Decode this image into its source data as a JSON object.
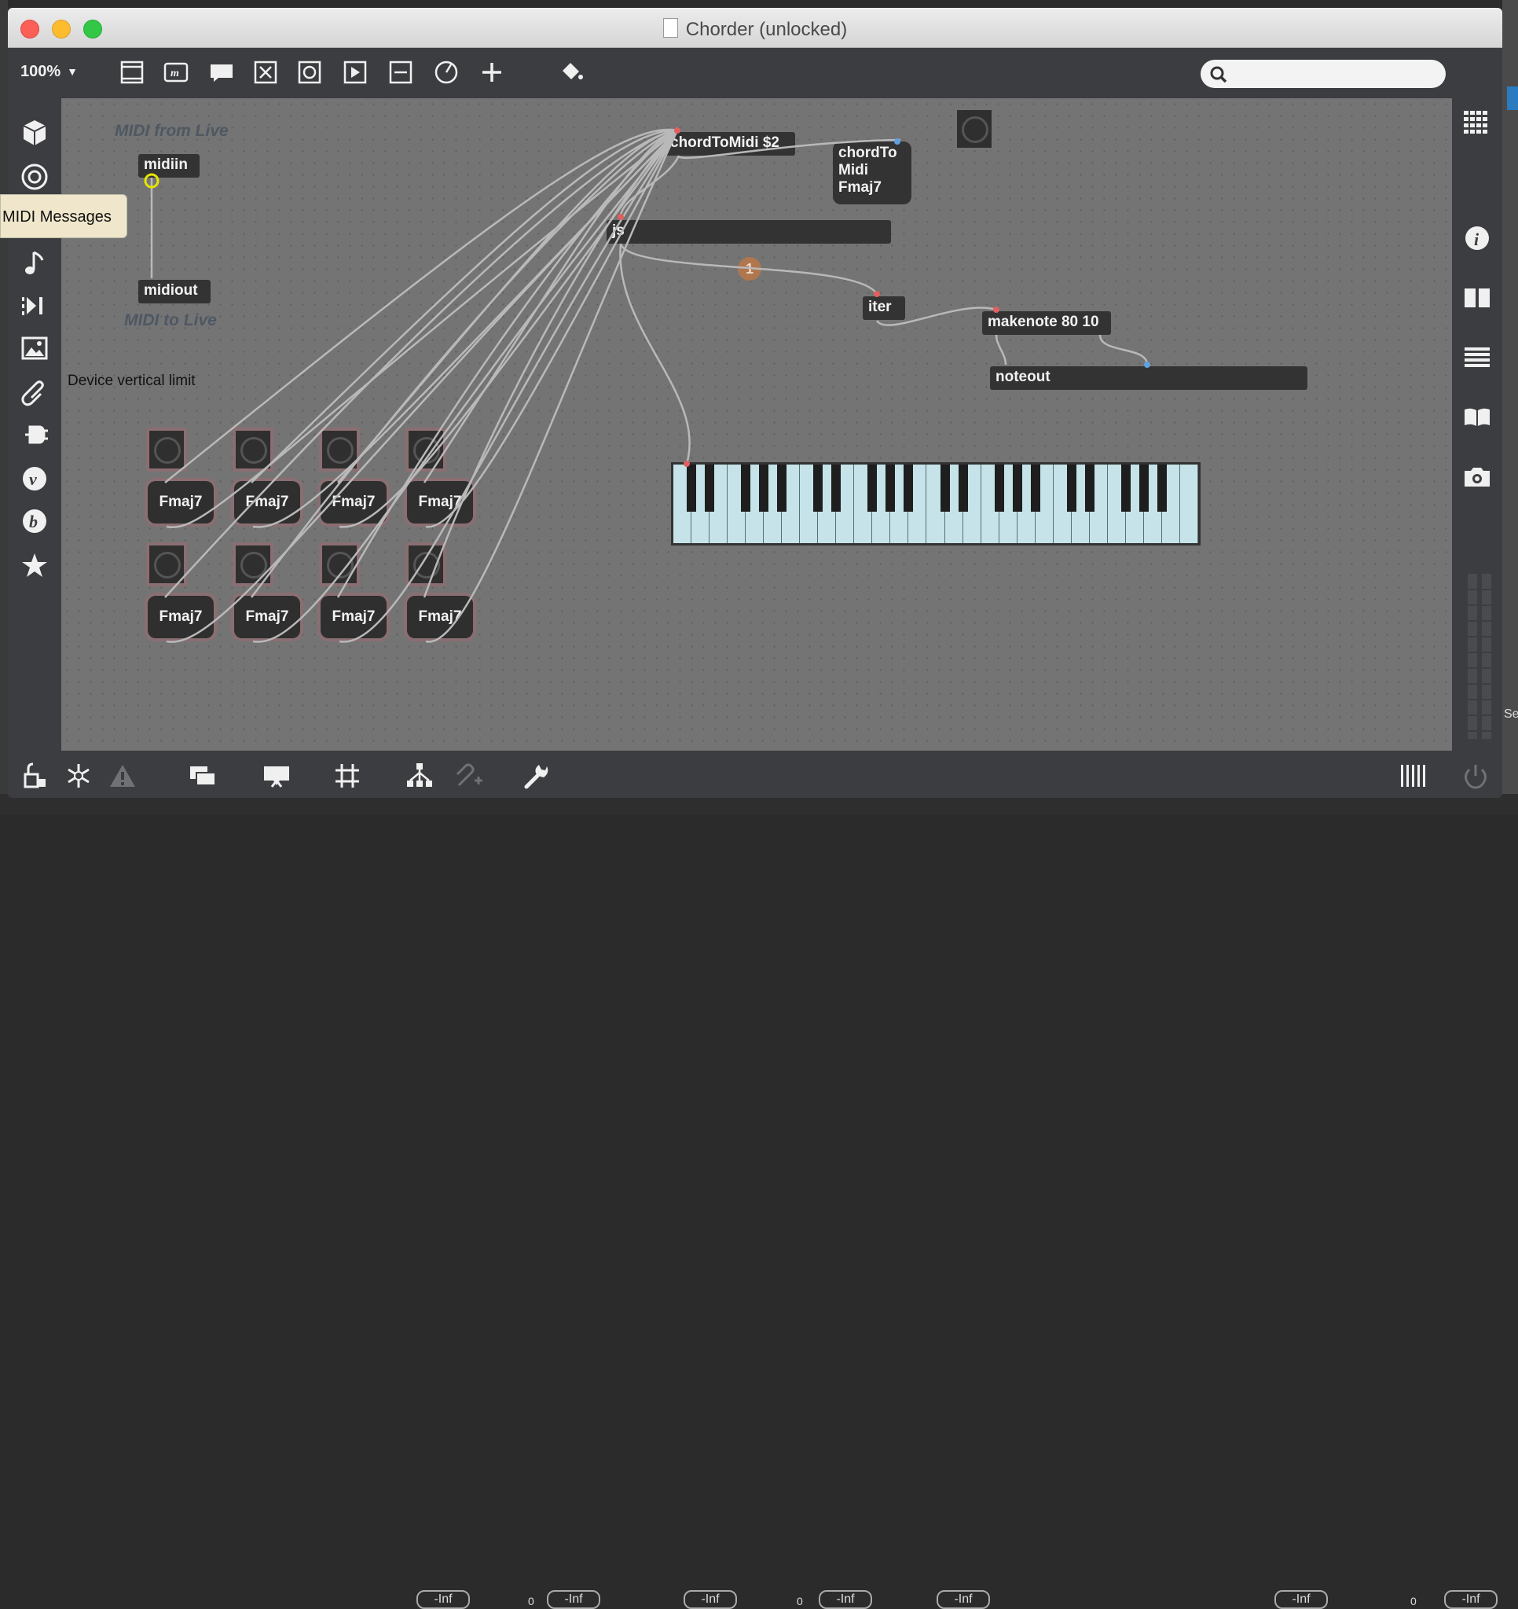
{
  "window": {
    "title": "Chorder (unlocked)"
  },
  "toolbar": {
    "zoom": "100%"
  },
  "search": {
    "placeholder": ""
  },
  "comments": {
    "midi_from_live": "MIDI from Live",
    "midi_to_live": "MIDI to Live",
    "device_limit": "Device vertical limit"
  },
  "objects": {
    "midiin": "midiin",
    "midiout": "midiout",
    "chord_to_midi_msg": "chordToMidi $2",
    "chord_to_midi_lines": [
      "chordTo",
      "Midi",
      "Fmaj7"
    ],
    "js": "js",
    "iter": "iter",
    "makenote": "makenote 80 10",
    "noteout": "noteout"
  },
  "chord_messages": [
    "Fmaj7",
    "Fmaj7",
    "Fmaj7",
    "Fmaj7",
    "Fmaj7",
    "Fmaj7",
    "Fmaj7",
    "Fmaj7"
  ],
  "badge": "1",
  "tooltip": "MIDI Messages",
  "bottom_meters": [
    "-Inf",
    "-Inf",
    "-Inf",
    "-Inf",
    "-Inf",
    "-Inf",
    "-Inf"
  ],
  "bottom_meter_values": [
    "0",
    "0",
    "0"
  ],
  "side_text": "Se",
  "colors": {
    "cable": "#b9b9b9",
    "highlight": "#e6e600",
    "accent_red": "#e03030"
  },
  "icons": {
    "toolbar": [
      "new-object-icon",
      "message-icon",
      "comment-icon",
      "toggle-icon",
      "button-icon",
      "play-icon",
      "slider-icon",
      "dial-icon",
      "plus-icon",
      "paint-bucket-icon"
    ],
    "left": [
      "cube-icon",
      "circle-icon",
      "keyboard-icon",
      "note-icon",
      "sequencer-icon",
      "image-icon",
      "paperclip-icon",
      "plug-icon",
      "v-icon",
      "b-icon",
      "star-icon"
    ],
    "right": [
      "grid-icon",
      "info-icon",
      "split-icon",
      "list-icon",
      "book-icon",
      "camera-icon"
    ],
    "bottom": [
      "lock-icon",
      "freeze-icon",
      "warning-icon",
      "windows-icon",
      "presentation-icon",
      "grid-icon",
      "hierarchy-icon",
      "snap-icon",
      "wrench-icon",
      "columns-icon",
      "power-icon"
    ]
  }
}
